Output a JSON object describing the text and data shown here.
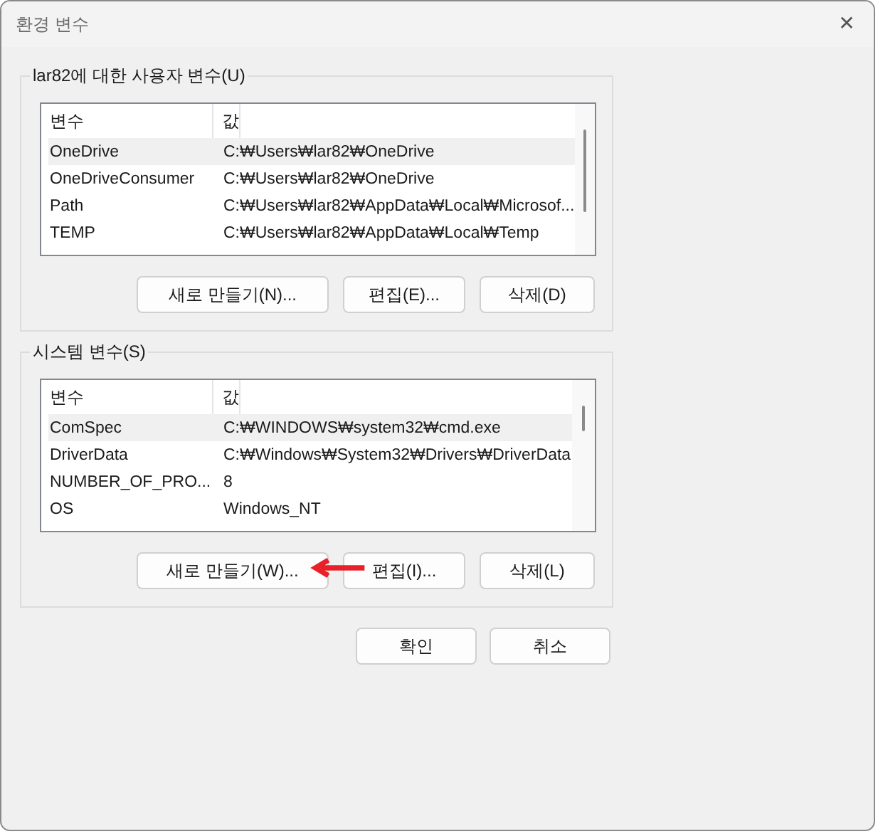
{
  "window": {
    "title": "환경 변수",
    "close": "✕"
  },
  "groups": [
    {
      "title": "lar82에 대한 사용자 변수(U)",
      "columns": [
        "변수",
        "값"
      ],
      "rows": [
        {
          "name": "OneDrive",
          "value": "C:₩Users₩lar82₩OneDrive",
          "selected": true
        },
        {
          "name": "OneDriveConsumer",
          "value": "C:₩Users₩lar82₩OneDrive",
          "selected": false
        },
        {
          "name": "Path",
          "value": "C:₩Users₩lar82₩AppData₩Local₩Microsof...",
          "selected": false
        },
        {
          "name": "TEMP",
          "value": "C:₩Users₩lar82₩AppData₩Local₩Temp",
          "selected": false
        }
      ],
      "buttons": [
        "새로 만들기(N)...",
        "편집(E)...",
        "삭제(D)"
      ],
      "annotated": false
    },
    {
      "title": "시스템 변수(S)",
      "columns": [
        "변수",
        "값"
      ],
      "rows": [
        {
          "name": "ComSpec",
          "value": "C:₩WINDOWS₩system32₩cmd.exe",
          "selected": true
        },
        {
          "name": "DriverData",
          "value": "C:₩Windows₩System32₩Drivers₩DriverData",
          "selected": false
        },
        {
          "name": "NUMBER_OF_PRO...",
          "value": "8",
          "selected": false
        },
        {
          "name": "OS",
          "value": "Windows_NT",
          "selected": false
        }
      ],
      "buttons": [
        "새로 만들기(W)...",
        "편집(I)...",
        "삭제(L)"
      ],
      "annotated": true
    }
  ],
  "buttons": [
    "확인",
    "취소"
  ]
}
